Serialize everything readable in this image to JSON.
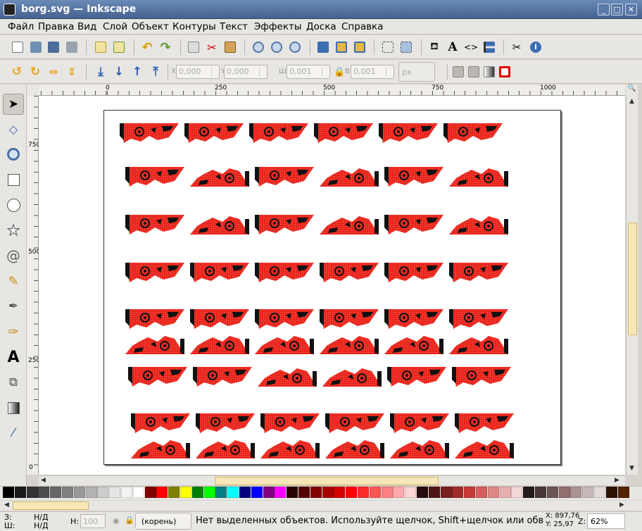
{
  "window": {
    "title": "borg.svg — Inkscape",
    "minimize": "_",
    "maximize": "□",
    "close": "✕"
  },
  "menu": [
    "Файл",
    "Правка",
    "Вид",
    "Слой",
    "Объект",
    "Контуры",
    "Текст",
    "Эффекты",
    "Доска",
    "Справка"
  ],
  "tool_controls": {
    "x_label": "X",
    "x_value": "0,000",
    "y_label": "Y",
    "y_value": "0,000",
    "w_label": "Ш",
    "w_value": "0,001",
    "h_label": "В",
    "h_value": "0,001",
    "unit": "px"
  },
  "ruler": {
    "h_ticks": [
      "0",
      "250",
      "500",
      "750",
      "1000"
    ],
    "v_ticks": [
      "750",
      "500",
      "250",
      "0"
    ]
  },
  "palette_colors": [
    "#000000",
    "#1a1a1a",
    "#333333",
    "#4d4d4d",
    "#666666",
    "#808080",
    "#999999",
    "#b3b3b3",
    "#cccccc",
    "#e6e6e6",
    "#f2f2f2",
    "#ffffff",
    "#800000",
    "#ff0000",
    "#808000",
    "#ffff00",
    "#008000",
    "#00ff00",
    "#008080",
    "#00ffff",
    "#000080",
    "#0000ff",
    "#800080",
    "#ff00ff",
    "#2b0000",
    "#550000",
    "#800000",
    "#aa0000",
    "#d40000",
    "#ff0000",
    "#ff2a2a",
    "#ff5555",
    "#ff8080",
    "#ffaaaa",
    "#ffd5d5",
    "#280b0b",
    "#501616",
    "#782121",
    "#a02c2c",
    "#c83737",
    "#d35f5f",
    "#de8787",
    "#e9afaf",
    "#f4d7d7",
    "#241c1c",
    "#483737",
    "#6c5353",
    "#916f6f",
    "#ac9393",
    "#c8b7b7",
    "#e3dbdb",
    "#2b1100",
    "#552200"
  ],
  "status": {
    "fill_label": "З:",
    "fill_value": "Н/Д",
    "stroke_label": "Ш:",
    "stroke_value": "Н/Д",
    "opacity_label": "Н:",
    "opacity_value": "100",
    "layer": "(корень)",
    "message": "Нет выделенных объектов. Используйте щелчок, Shift+щелчок или обвед...",
    "cursor_x": "X: 897,76",
    "cursor_y": "Y:  25,97",
    "zoom_label": "Z:",
    "zoom_value": "62%"
  }
}
